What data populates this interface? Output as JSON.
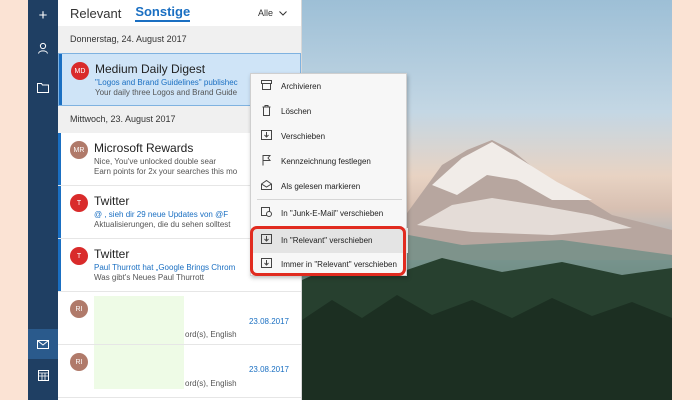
{
  "rail": {
    "icons": [
      "plus-icon",
      "person-icon",
      "folder-icon",
      "mail-icon",
      "calendar-icon"
    ],
    "accent": "#1f3f63"
  },
  "tabs": {
    "focused": "Relevant",
    "other": "Sonstige",
    "filter": "Alle"
  },
  "groups": [
    {
      "date": "Donnerstag, 24. August 2017"
    },
    {
      "date": "Mittwoch, 23. August 2017"
    }
  ],
  "mails": [
    {
      "initials": "MD",
      "color": "#d92b2b",
      "sender": "Medium Daily Digest",
      "subject": "\"Logos and Brand Guidelines\" publishec",
      "preview": "Your daily three  Logos and Brand Guide"
    },
    {
      "initials": "MR",
      "color": "#b07a6a",
      "sender": "Microsoft Rewards",
      "subject": "Nice,         You've unlocked double sear",
      "preview": "Earn points for 2x your searches this mo"
    },
    {
      "initials": "T",
      "color": "#d92b2b",
      "sender": "Twitter",
      "subject": "@      , sieh dir 29 neue Updates von @F",
      "preview": "Aktualisierungen, die du sehen solltest"
    },
    {
      "initials": "T",
      "color": "#d92b2b",
      "sender": "Twitter",
      "subject": "Paul Thurrott hat „Google Brings Chrom",
      "preview": "Was gibt's Neues            Paul Thurrott"
    },
    {
      "initials": "RI",
      "color": "#b07a6a",
      "date": "23.08.2017",
      "tail": "ord(s), English"
    },
    {
      "initials": "RI",
      "color": "#b07a6a",
      "date": "23.08.2017",
      "tail": "ord(s), English"
    }
  ],
  "menu": {
    "items": [
      {
        "label": "Archivieren",
        "icon": "archive-icon"
      },
      {
        "label": "Löschen",
        "icon": "trash-icon"
      },
      {
        "label": "Verschieben",
        "icon": "move-icon"
      },
      {
        "label": "Kennzeichnung festlegen",
        "icon": "flag-icon"
      },
      {
        "label": "Als gelesen markieren",
        "icon": "envelope-open-icon"
      },
      {
        "label": "In \"Junk-E-Mail\" verschieben",
        "icon": "junk-icon"
      },
      {
        "label": "In \"Relevant\" verschieben",
        "icon": "move-focused-icon"
      },
      {
        "label": "Immer in \"Relevant\" verschieben",
        "icon": "always-focused-icon"
      }
    ]
  },
  "colors": {
    "accent": "#1a6fc2",
    "highlight": "#e12b1f"
  }
}
